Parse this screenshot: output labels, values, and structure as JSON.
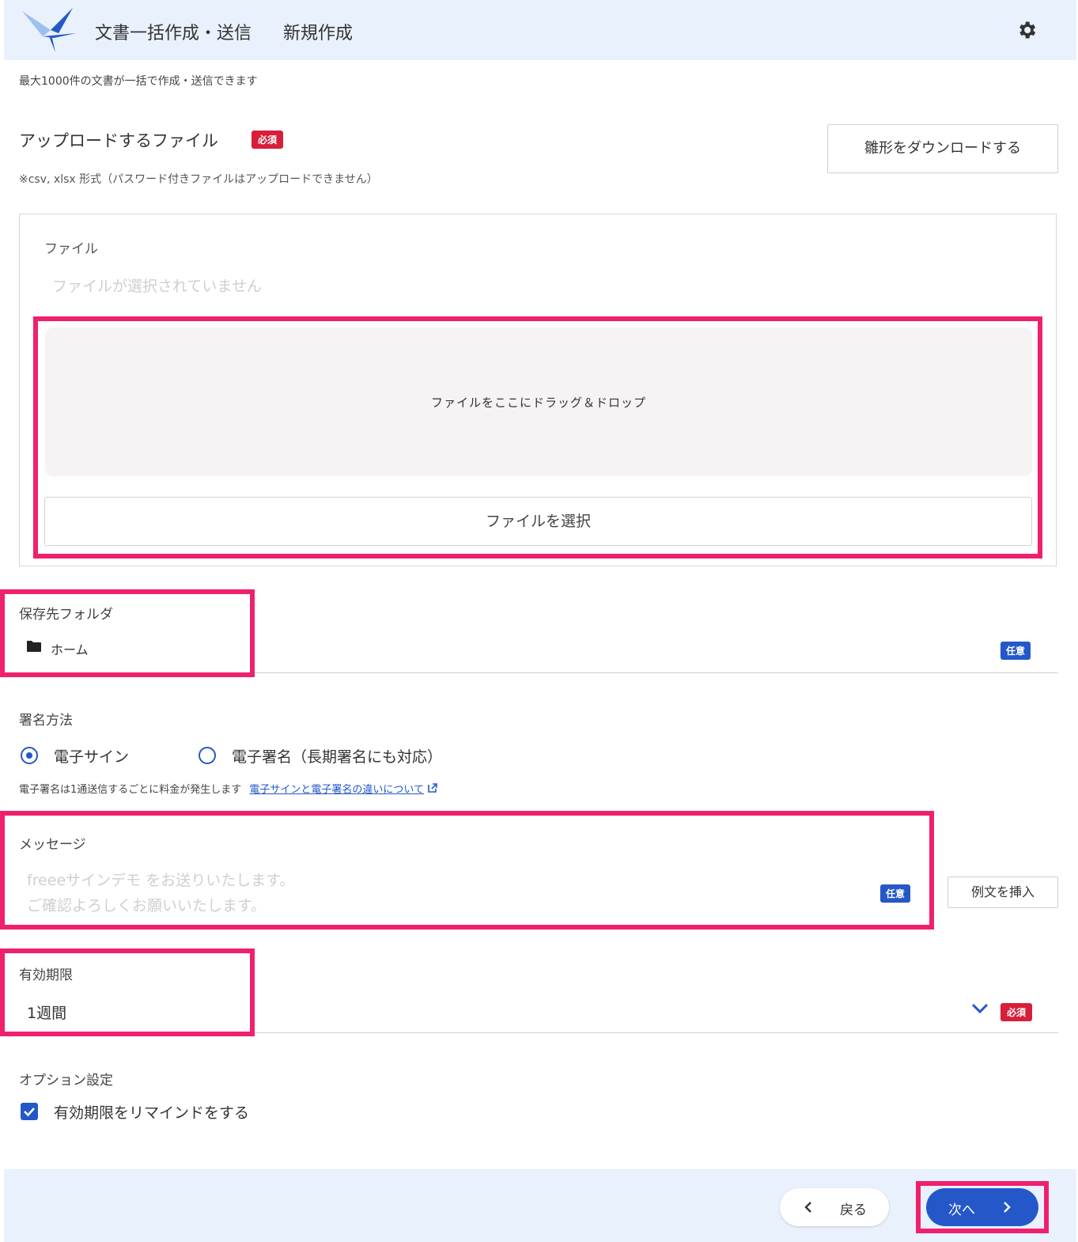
{
  "header": {
    "title": "文書一括作成・送信",
    "subtitle": "新規作成"
  },
  "intro": "最大1000件の文書が一括で作成・送信できます",
  "upload": {
    "title": "アップロードするファイル",
    "required_badge": "必須",
    "note": "※csv, xlsx 形式（パスワード付きファイルはアップロードできません）",
    "template_button": "雛形をダウンロードする",
    "file_label": "ファイル",
    "file_status": "ファイルが選択されていません",
    "drop_text": "ファイルをここにドラッグ＆ドロップ",
    "select_button": "ファイルを選択"
  },
  "folder": {
    "label": "保存先フォルダ",
    "value": "ホーム",
    "optional_badge": "任意"
  },
  "signature": {
    "label": "署名方法",
    "options": [
      "電子サイン",
      "電子署名（長期署名にも対応）"
    ],
    "selected": "電子サイン",
    "note": "電子署名は1通送信するごとに料金が発生します",
    "link": "電子サインと電子署名の違いについて"
  },
  "message": {
    "label": "メッセージ",
    "placeholder_line1": "freeeサインデモ をお送りいたします。",
    "placeholder_line2": "ご確認よろしくお願いいたします。",
    "optional_badge": "任意",
    "insert_button": "例文を挿入"
  },
  "expiry": {
    "label": "有効期限",
    "value": "1週間",
    "required_badge": "必須"
  },
  "options": {
    "label": "オプション設定",
    "remind_label": "有効期限をリマインドをする",
    "remind_checked": true
  },
  "footer": {
    "back_label": "戻る",
    "next_label": "次へ"
  },
  "colors": {
    "accent": "#2458c9",
    "required": "#d81e3a",
    "highlight": "#f0206e",
    "header_bg": "#e9f1fc"
  }
}
